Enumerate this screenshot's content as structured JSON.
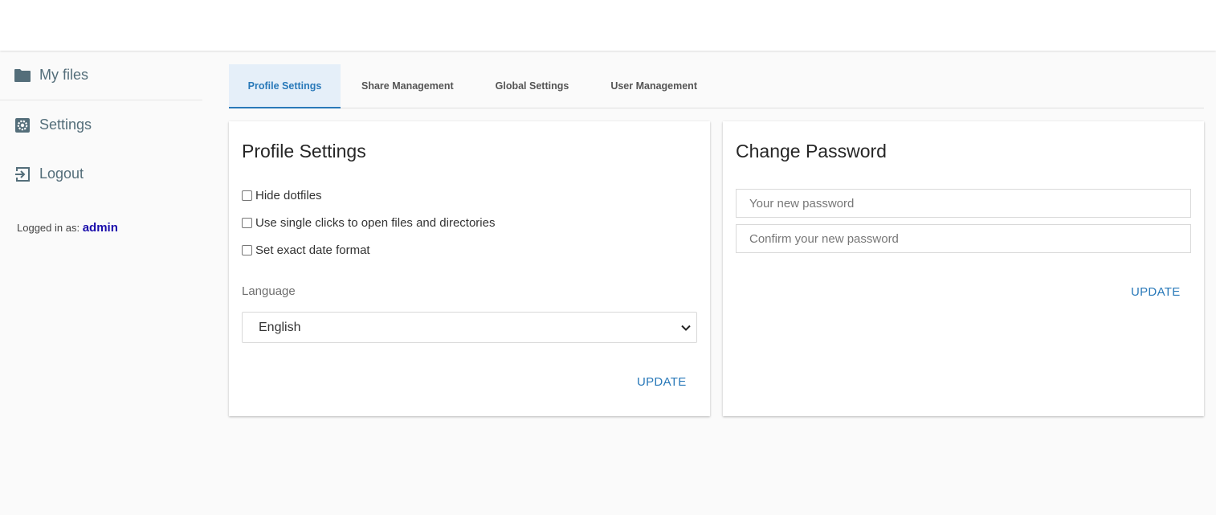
{
  "sidebar": {
    "items": [
      {
        "label": "My files",
        "icon": "folder-icon"
      },
      {
        "label": "Settings",
        "icon": "settings-icon"
      },
      {
        "label": "Logout",
        "icon": "logout-icon"
      }
    ],
    "logged_in_prefix": "Logged in as:",
    "username": "admin"
  },
  "tabs": [
    {
      "label": "Profile Settings",
      "active": true
    },
    {
      "label": "Share Management",
      "active": false
    },
    {
      "label": "Global Settings",
      "active": false
    },
    {
      "label": "User Management",
      "active": false
    }
  ],
  "profile": {
    "title": "Profile Settings",
    "options": [
      {
        "label": "Hide dotfiles",
        "checked": false
      },
      {
        "label": "Use single clicks to open files and directories",
        "checked": false
      },
      {
        "label": "Set exact date format",
        "checked": false
      }
    ],
    "language_label": "Language",
    "language_value": "English",
    "update_label": "UPDATE"
  },
  "password": {
    "title": "Change Password",
    "new_placeholder": "Your new password",
    "confirm_placeholder": "Confirm your new password",
    "update_label": "UPDATE"
  },
  "colors": {
    "accent": "#2979b9",
    "tab_active_bg": "#e5eff9",
    "sidebar_text": "#546e7a",
    "username": "#1a0dab"
  }
}
